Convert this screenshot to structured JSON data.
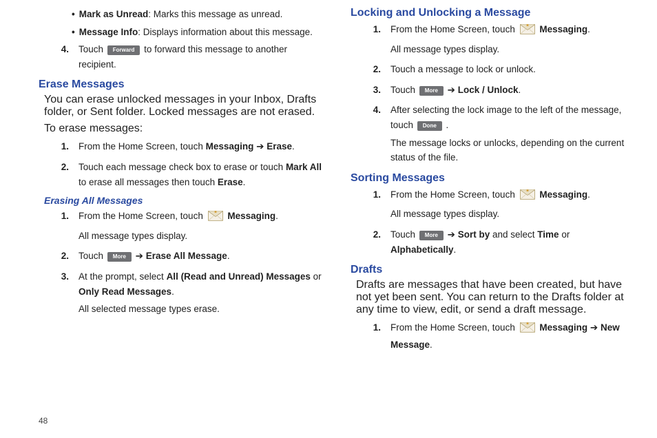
{
  "pageNumber": "48",
  "buttons": {
    "forward": "Forward",
    "more": "More",
    "done": "Done"
  },
  "leftCol": {
    "topBullets": [
      {
        "term": "Mark as Unread",
        "desc": ": Marks this message as unread."
      },
      {
        "term": "Message Info",
        "desc": ": Displays information about this message."
      }
    ],
    "step4": {
      "num": "4.",
      "before": "Touch ",
      "after": " to forward this message to another recipient."
    },
    "erase": {
      "title": "Erase Messages",
      "intro": "You can erase unlocked messages in your Inbox, Drafts folder, or Sent folder. Locked messages are not erased.",
      "lead": "To erase messages:",
      "steps": [
        {
          "num": "1.",
          "parts": [
            "From the Home Screen, touch ",
            "Messaging",
            " ➔ ",
            "Erase",
            "."
          ]
        },
        {
          "num": "2.",
          "parts": [
            "Touch each message check box to erase or touch ",
            "Mark All",
            " to erase all messages then touch ",
            "Erase",
            "."
          ]
        }
      ]
    },
    "eraseAll": {
      "title": "Erasing All Messages",
      "steps": {
        "s1": {
          "num": "1.",
          "before": "From the Home Screen, touch ",
          "bold": "Messaging",
          "after": ".",
          "sub": "All message types display."
        },
        "s2": {
          "num": "2.",
          "before": "Touch ",
          "mid": " ➔ ",
          "bold": "Erase All Message",
          "after": "."
        },
        "s3": {
          "num": "3.",
          "before": "At the prompt, select ",
          "bold1": "All (Read and Unread) Messages",
          "mid": " or ",
          "bold2": "Only Read Messages",
          "after": ".",
          "sub": "All selected message types erase."
        }
      }
    }
  },
  "rightCol": {
    "lock": {
      "title": "Locking and Unlocking a Message",
      "steps": {
        "s1": {
          "num": "1.",
          "before": "From the Home Screen, touch ",
          "bold": "Messaging",
          "after": ".",
          "sub": "All message types display."
        },
        "s2": {
          "num": "2.",
          "text": "Touch a message to lock or unlock."
        },
        "s3": {
          "num": "3.",
          "before": "Touch ",
          "mid": " ➔ ",
          "bold": "Lock / Unlock",
          "after": "."
        },
        "s4": {
          "num": "4.",
          "before": "After selecting the lock image to the left of the message, touch ",
          "after": " .",
          "sub": "The message locks or unlocks, depending on the current status of the file."
        }
      }
    },
    "sort": {
      "title": "Sorting Messages",
      "steps": {
        "s1": {
          "num": "1.",
          "before": "From the Home Screen, touch ",
          "bold": "Messaging",
          "after": ".",
          "sub": "All message types display."
        },
        "s2": {
          "num": "2.",
          "before": "Touch ",
          "mid": " ➔ ",
          "bold1": "Sort by",
          "mid2": " and select ",
          "bold2": "Time",
          "mid3": " or ",
          "bold3": "Alphabetically",
          "after": "."
        }
      }
    },
    "drafts": {
      "title": "Drafts",
      "intro": "Drafts are messages that have been created, but have not yet been sent. You can return to the Drafts folder at any time to view, edit, or send a draft message.",
      "step1": {
        "num": "1.",
        "before": "From the Home Screen, touch ",
        "bold1": "Messaging",
        "mid": " ➔ ",
        "bold2": "New Message",
        "after": "."
      }
    }
  }
}
